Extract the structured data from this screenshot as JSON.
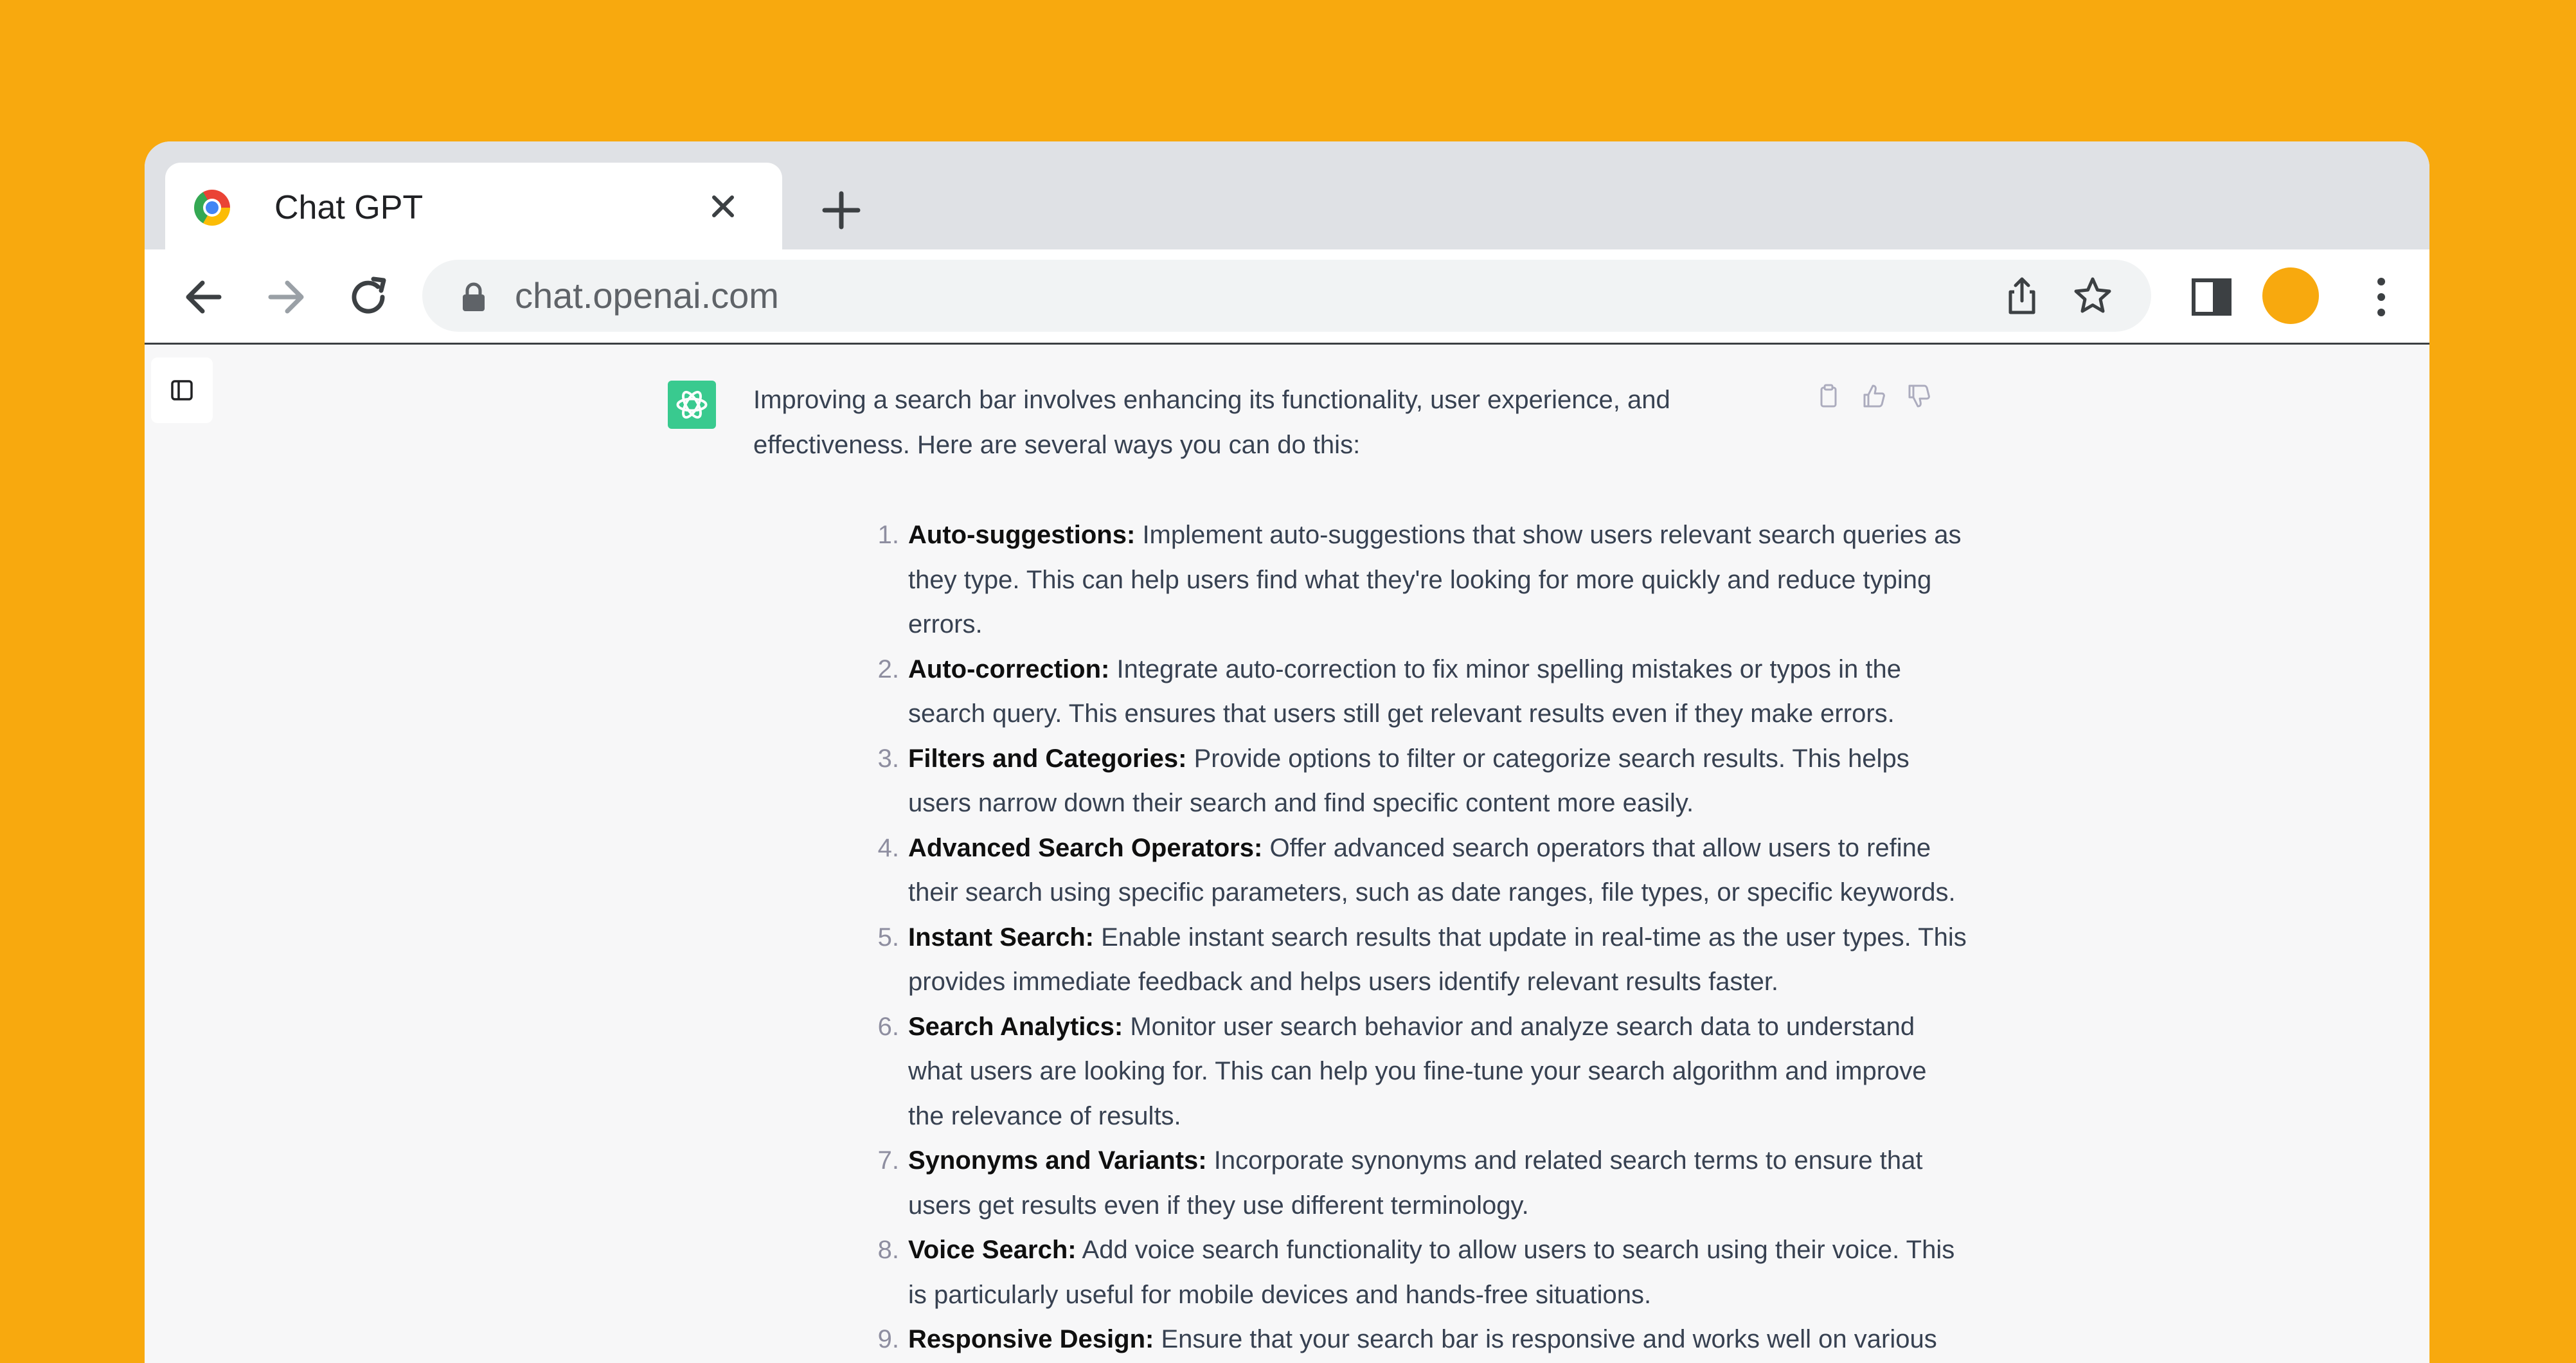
{
  "browser": {
    "tab": {
      "title": "Chat GPT",
      "favicon": "chrome-icon"
    },
    "address_bar": {
      "url": "chat.openai.com",
      "icon": "lock-icon"
    },
    "profile_color": "#F8A90E",
    "background_color": "#F8A90E"
  },
  "chat": {
    "assistant_avatar": "openai-logo-icon",
    "intro": "Improving a search bar involves enhancing its functionality, user experience, and effectiveness. Here are several ways you can do this:",
    "items": [
      {
        "num": "1.",
        "title": "Auto-suggestions:",
        "text": "Implement auto-suggestions that show users relevant search queries as they type. This can help users find what they're looking for more quickly and reduce typing errors."
      },
      {
        "num": "2.",
        "title": "Auto-correction:",
        "text": "Integrate auto-correction to fix minor spelling mistakes or typos in the search query. This ensures that users still get relevant results even if they make errors."
      },
      {
        "num": "3.",
        "title": "Filters and Categories:",
        "text": "Provide options to filter or categorize search results. This helps users narrow down their search and find specific content more easily."
      },
      {
        "num": "4.",
        "title": "Advanced Search Operators:",
        "text": "Offer advanced search operators that allow users to refine their search using specific parameters, such as date ranges, file types, or specific keywords."
      },
      {
        "num": "5.",
        "title": "Instant Search:",
        "text": "Enable instant search results that update in real-time as the user types. This provides immediate feedback and helps users identify relevant results faster."
      },
      {
        "num": "6.",
        "title": "Search Analytics:",
        "text": "Monitor user search behavior and analyze search data to understand what users are looking for. This can help you fine-tune your search algorithm and improve the relevance of results."
      },
      {
        "num": "7.",
        "title": "Synonyms and Variants:",
        "text": "Incorporate synonyms and related search terms to ensure that users get results even if they use different terminology."
      },
      {
        "num": "8.",
        "title": "Voice Search:",
        "text": "Add voice search functionality to allow users to search using their voice. This is particularly useful for mobile devices and hands-free situations."
      },
      {
        "num": "9.",
        "title": "Responsive Design:",
        "text": "Ensure that your search bar is responsive and works well on various"
      }
    ]
  }
}
